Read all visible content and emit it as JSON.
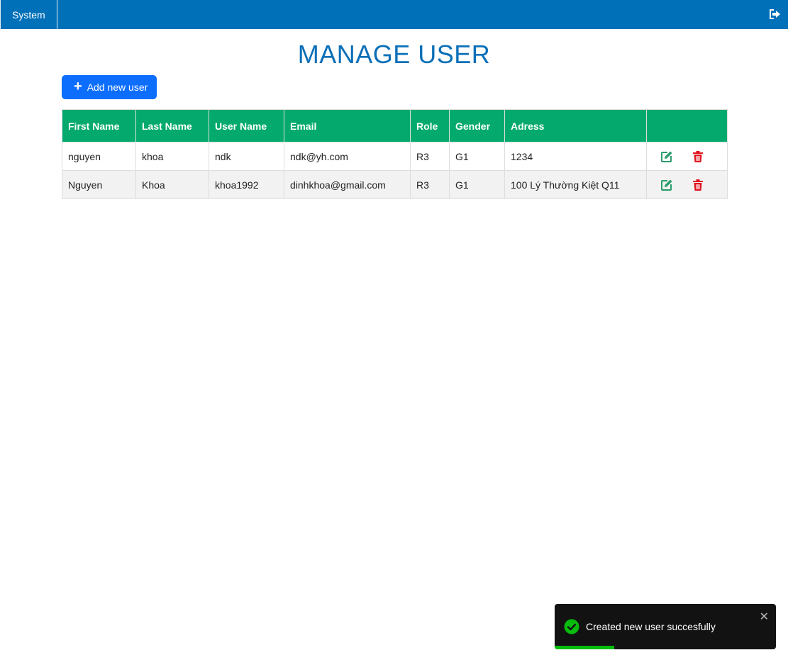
{
  "topbar": {
    "menu_label": "System"
  },
  "page": {
    "title": "MANAGE USER"
  },
  "toolbar": {
    "add_label": "Add new user"
  },
  "table": {
    "headers": [
      "First Name",
      "Last Name",
      "User Name",
      "Email",
      "Role",
      "Gender",
      "Adress",
      ""
    ],
    "rows": [
      {
        "first_name": "nguyen",
        "last_name": "khoa",
        "user_name": "ndk",
        "email": "ndk@yh.com",
        "role": "R3",
        "gender": "G1",
        "address": "1234"
      },
      {
        "first_name": "Nguyen",
        "last_name": "Khoa",
        "user_name": "khoa1992",
        "email": "dinhkhoa@gmail.com",
        "role": "R3",
        "gender": "G1",
        "address": "100 Lý Thường Kiệt Q11"
      }
    ]
  },
  "toast": {
    "message": "Created new user succesfully",
    "close_glyph": "✕",
    "progress": 0.27
  },
  "colors": {
    "topbar": "#0070b9",
    "title": "#0b6fb8",
    "button": "#0d6efd",
    "header": "#04aa6d",
    "edit": "#2a9d6a",
    "delete": "#e0141e",
    "toast_success": "#07bc0c"
  }
}
